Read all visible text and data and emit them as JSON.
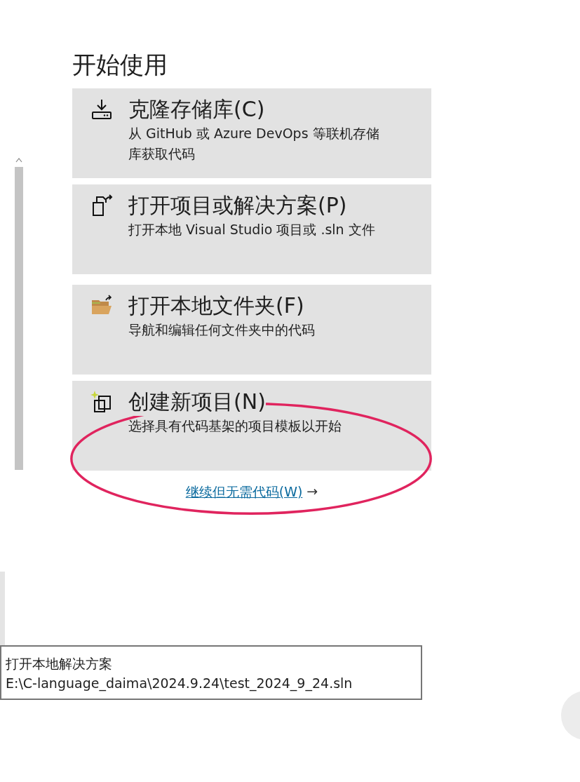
{
  "heading": "开始使用",
  "actions": [
    {
      "title": "克隆存储库(C)",
      "description": "从 GitHub 或 Azure DevOps 等联机存储库获取代码"
    },
    {
      "title": "打开项目或解决方案(P)",
      "description": "打开本地 Visual Studio 项目或 .sln 文件"
    },
    {
      "title": "打开本地文件夹(F)",
      "description": "导航和编辑任何文件夹中的代码"
    },
    {
      "title": "创建新项目(N)",
      "description": "选择具有代码基架的项目模板以开始"
    }
  ],
  "continue_link": {
    "label": "继续但无需代码(W)",
    "arrow": "→"
  },
  "annotation": {
    "kind": "ellipse"
  },
  "tooltip": {
    "title": "打开本地解决方案",
    "path": "E:\\C-language_daima\\2024.9.24\\test_2024_9_24.sln"
  }
}
